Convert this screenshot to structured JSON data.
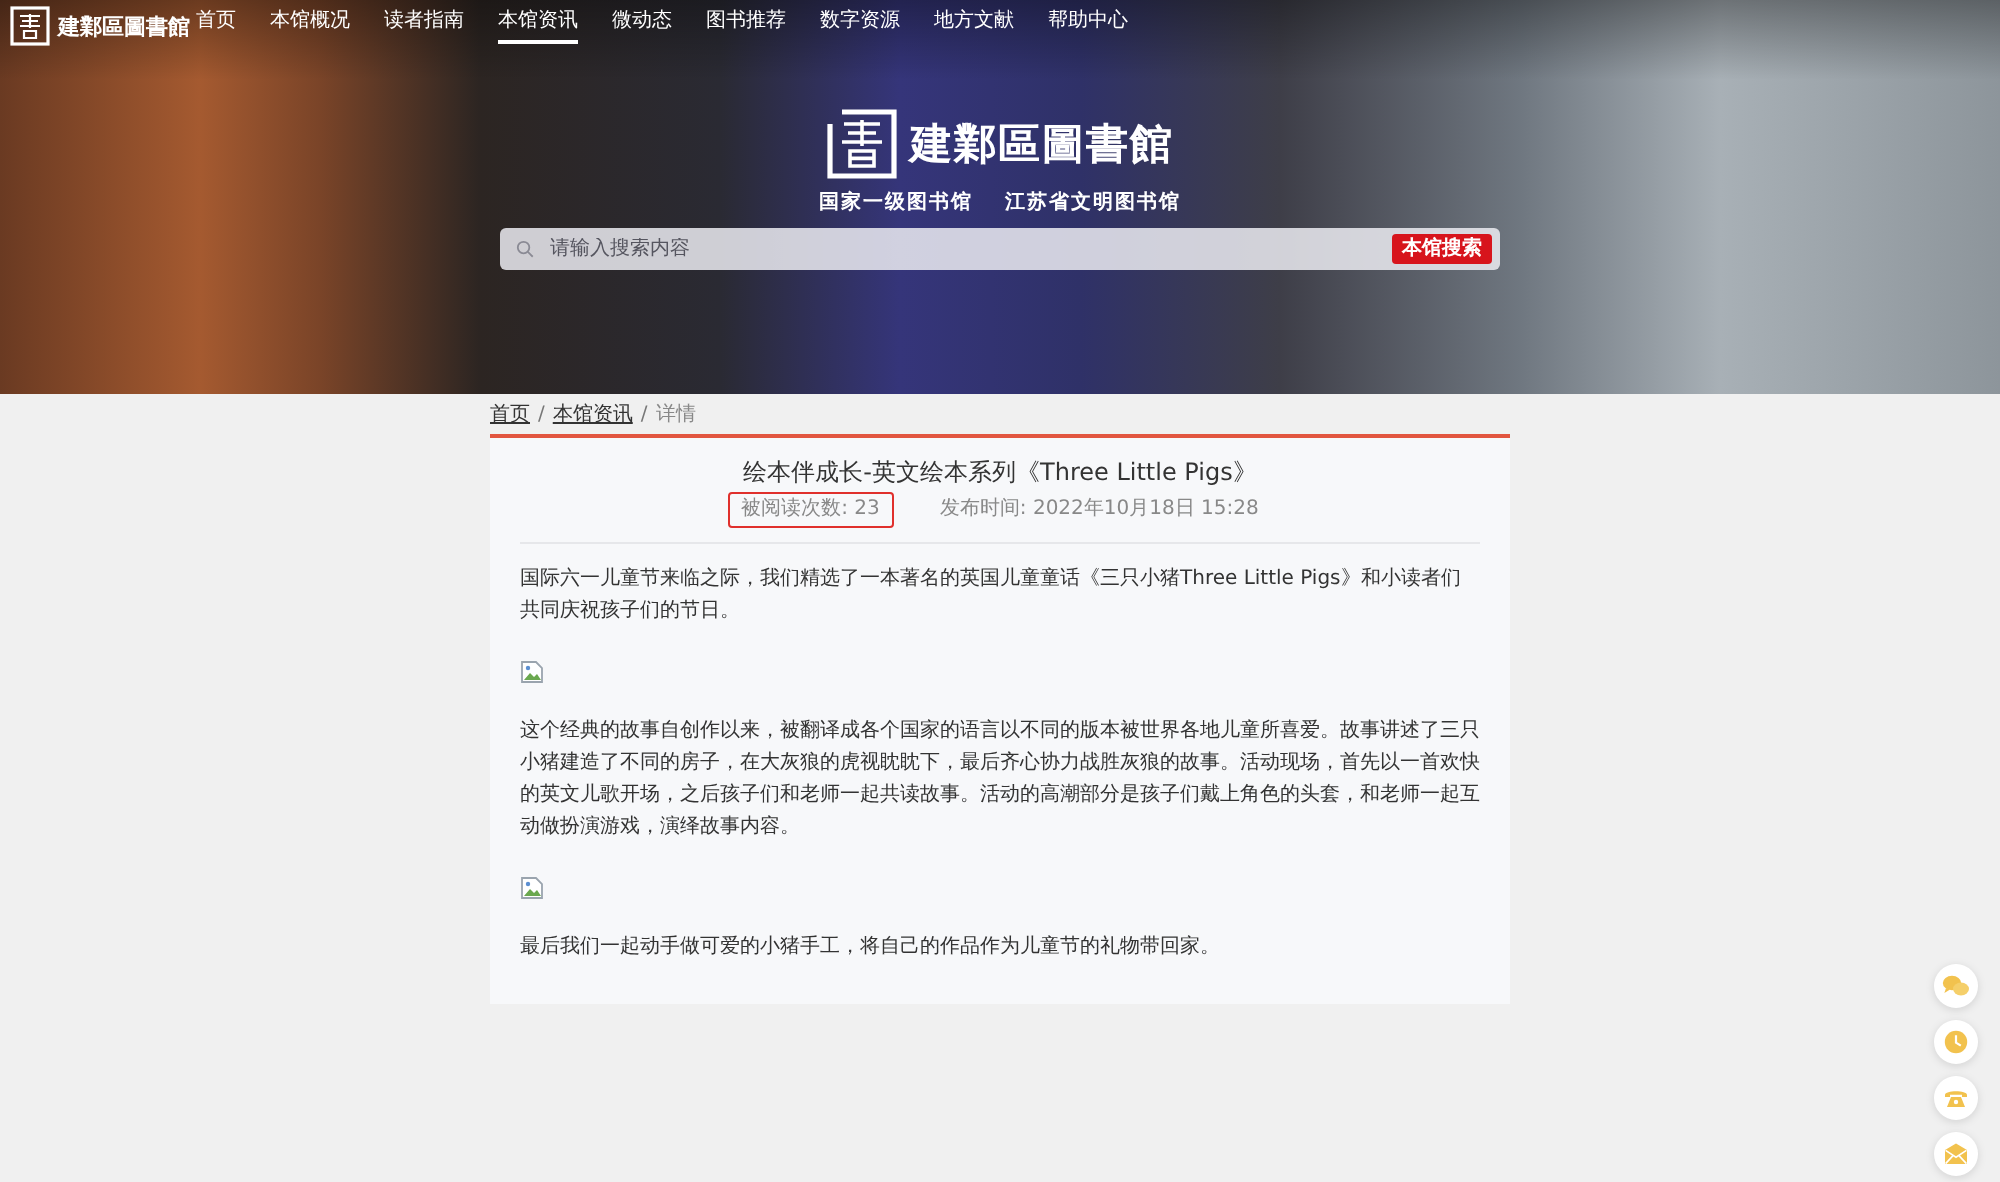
{
  "nav": {
    "brand": "建鄴區圖書館",
    "items": [
      {
        "label": "首页",
        "selected": false
      },
      {
        "label": "本馆概况",
        "selected": false
      },
      {
        "label": "读者指南",
        "selected": false
      },
      {
        "label": "本馆资讯",
        "selected": true
      },
      {
        "label": "微动态",
        "selected": false
      },
      {
        "label": "图书推荐",
        "selected": false
      },
      {
        "label": "数字资源",
        "selected": false
      },
      {
        "label": "地方文献",
        "selected": false
      },
      {
        "label": "帮助中心",
        "selected": false
      }
    ]
  },
  "hero": {
    "title": "建鄴區圖書館",
    "mottos": [
      "国家一级图书馆",
      "江苏省文明图书馆"
    ],
    "search": {
      "placeholder": "请输入搜索内容",
      "button": "本馆搜索"
    }
  },
  "breadcrumb": [
    {
      "kind": "link",
      "text": "首页"
    },
    {
      "kind": "separator",
      "text": "/"
    },
    {
      "kind": "link",
      "text": "本馆资讯"
    },
    {
      "kind": "separator",
      "text": "/"
    },
    {
      "kind": "current",
      "text": "详情"
    }
  ],
  "article": {
    "title": "绘本伴成长-英文绘本系列《Three Little Pigs》",
    "meta": [
      {
        "text": "被阅读次数: 23",
        "highlighted": true
      },
      {
        "text": "发布时间: 2022年10月18日 15:28",
        "highlighted": false
      }
    ],
    "blocks": [
      {
        "kind": "paragraph",
        "text": "国际六一儿童节来临之际，我们精选了一本著名的英国儿童童话《三只小猪Three Little Pigs》和小读者们共同庆祝孩子们的节日。"
      },
      {
        "kind": "image"
      },
      {
        "kind": "paragraph",
        "text": "这个经典的故事自创作以来，被翻译成各个国家的语言以不同的版本被世界各地儿童所喜爱。故事讲述了三只小猪建造了不同的房子，在大灰狼的虎视眈眈下，最后齐心协力战胜灰狼的故事。活动现场，首先以一首欢快的英文儿歌开场，之后孩子们和老师一起共读故事。活动的高潮部分是孩子们戴上角色的头套，和老师一起互动做扮演游戏，演绎故事内容。"
      },
      {
        "kind": "image"
      },
      {
        "kind": "paragraph",
        "text": "最后我们一起动手做可爱的小猪手工，将自己的作品作为儿童节的礼物带回家。"
      }
    ]
  }
}
